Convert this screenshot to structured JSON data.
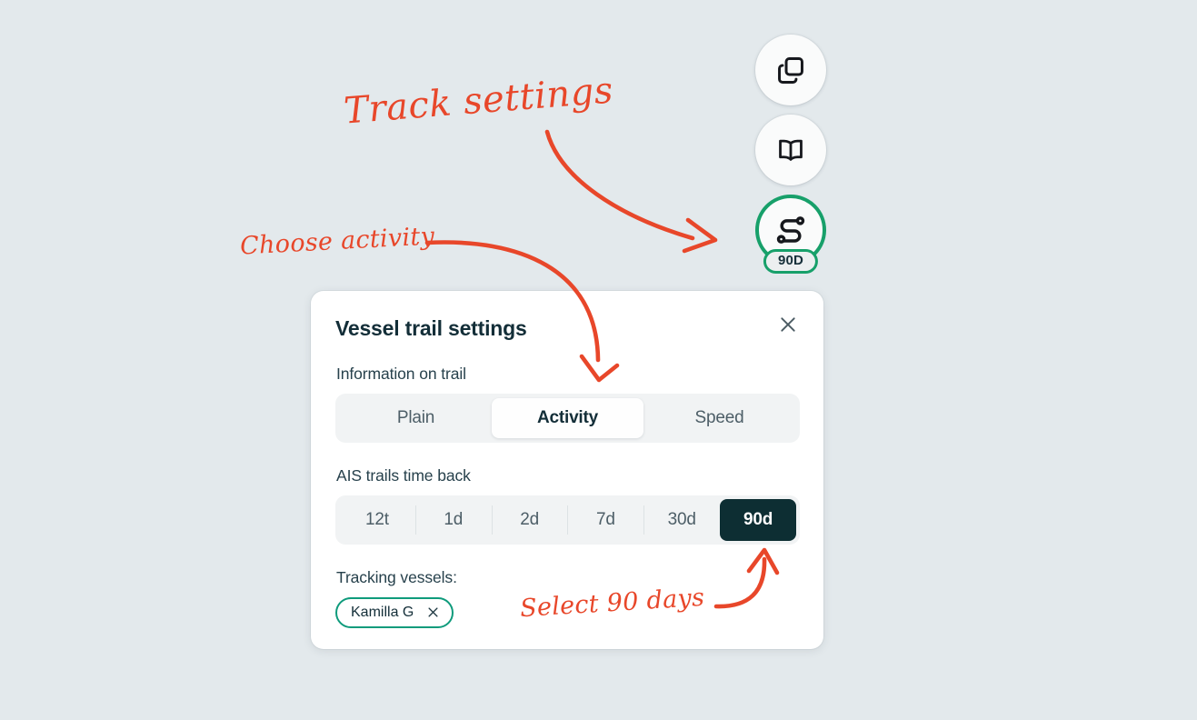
{
  "background_color": "#e3e9ec",
  "accent_color": "#17a06a",
  "annotation_color": "#e8472a",
  "selected_color": "#0d2e33",
  "chip_border_color": "#0f9b7c",
  "toolbar": {
    "buttons": [
      {
        "icon": "copy-layers-icon",
        "label": "Copy layers",
        "active": false,
        "badge": null
      },
      {
        "icon": "open-book-icon",
        "label": "Open book",
        "active": false,
        "badge": null
      },
      {
        "icon": "vessel-track-icon",
        "label": "Vessel track",
        "active": true,
        "badge": "90D"
      }
    ]
  },
  "panel": {
    "title": "Vessel trail settings",
    "close_label": "×",
    "information_on_trail": {
      "label": "Information on trail",
      "options": [
        "Plain",
        "Activity",
        "Speed"
      ],
      "selected": "Activity"
    },
    "ais_trails_time_back": {
      "label": "AIS trails time back",
      "options": [
        "12t",
        "1d",
        "2d",
        "7d",
        "30d",
        "90d"
      ],
      "selected": "90d"
    },
    "tracking_vessels": {
      "label": "Tracking vessels:",
      "chips": [
        {
          "name": "Kamilla G",
          "remove_label": "✕"
        }
      ]
    }
  },
  "annotations": [
    {
      "id": "track-settings",
      "text": "Track settings"
    },
    {
      "id": "choose-activity",
      "text": "Choose activity"
    },
    {
      "id": "select-90-days",
      "text": "Select 90 days"
    }
  ]
}
